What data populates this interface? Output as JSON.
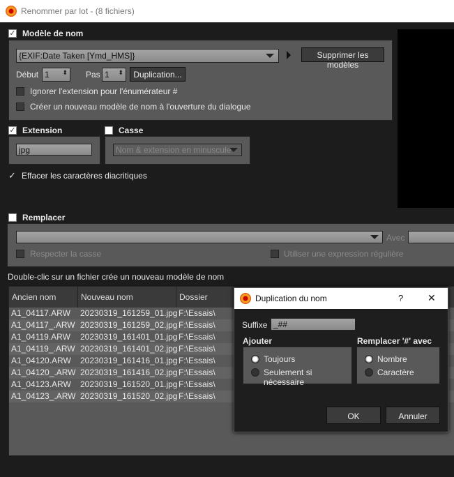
{
  "window": {
    "title": "Renommer par lot - (8 fichiers)"
  },
  "model": {
    "header": "Modèle de nom",
    "checked": true,
    "template": "{EXIF:Date Taken [Ymd_HMS]}",
    "delete_button": "Supprimer les modèles",
    "start_label": "Début",
    "start_value": "1",
    "step_label": "Pas",
    "step_value": "1",
    "duplication_button": "Duplication...",
    "opt_ignore_ext": "Ignorer l'extension pour l'énumérateur #",
    "opt_new_model": "Créer un nouveau modèle de nom à l'ouverture du dialogue"
  },
  "extension": {
    "header": "Extension",
    "checked": true,
    "value": "jpg"
  },
  "case": {
    "header": "Casse",
    "checked": false,
    "value": "Nom & extension en minuscule"
  },
  "diacritics": {
    "label": "Effacer les caractères diacritiques",
    "checked": true
  },
  "replace": {
    "header": "Remplacer",
    "checked": false,
    "with_label": "Avec",
    "match_case": "Respecter la casse",
    "regex": "Utiliser une expression régulière"
  },
  "hint": "Double-clic sur un fichier crée un nouveau modèle de nom",
  "table": {
    "columns": [
      "Ancien nom",
      "Nouveau nom",
      "Dossier"
    ],
    "rows": [
      [
        "A1_04117.ARW",
        "20230319_161259_01.jpg",
        "F:\\Essais\\"
      ],
      [
        "A1_04117_.ARW",
        "20230319_161259_02.jpg",
        "F:\\Essais\\"
      ],
      [
        "A1_04119.ARW",
        "20230319_161401_01.jpg",
        "F:\\Essais\\"
      ],
      [
        "A1_04119_.ARW",
        "20230319_161401_02.jpg",
        "F:\\Essais\\"
      ],
      [
        "A1_04120.ARW",
        "20230319_161416_01.jpg",
        "F:\\Essais\\"
      ],
      [
        "A1_04120_.ARW",
        "20230319_161416_02.jpg",
        "F:\\Essais\\"
      ],
      [
        "A1_04123.ARW",
        "20230319_161520_01.jpg",
        "F:\\Essais\\"
      ],
      [
        "A1_04123_.ARW",
        "20230319_161520_02.jpg",
        "F:\\Essais\\"
      ]
    ]
  },
  "dialog": {
    "title": "Duplication du nom",
    "help": "?",
    "close": "✕",
    "suffix_label": "Suffixe",
    "suffix_value": "_##",
    "add_header": "Ajouter",
    "add_always": "Toujours",
    "add_if_needed": "Seulement si nécessaire",
    "replace_header": "Remplacer '#' avec",
    "replace_number": "Nombre",
    "replace_char": "Caractère",
    "ok": "OK",
    "cancel": "Annuler"
  }
}
